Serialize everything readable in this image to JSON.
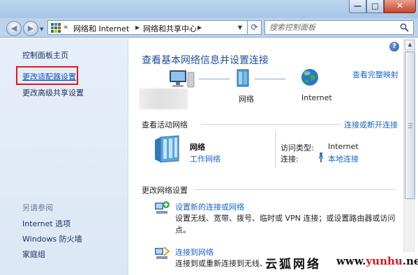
{
  "window": {
    "controls": {
      "minimize": "—",
      "maximize": "□",
      "close": "✕"
    }
  },
  "nav": {
    "back_icon": "back-arrow-icon",
    "forward_icon": "forward-arrow-icon",
    "breadcrumb_prefix": "«",
    "breadcrumbs": [
      "网络和 Internet",
      "网络和共享中心"
    ],
    "search_placeholder": "搜索控制面板"
  },
  "sidebar": {
    "items": [
      {
        "label": "控制面板主页"
      },
      {
        "label": "更改适配器设置",
        "highlighted": true
      },
      {
        "label": "更改高级共享设置"
      }
    ],
    "see_also_heading": "另请参阅",
    "see_also": [
      {
        "label": "Internet 选项"
      },
      {
        "label": "Windows 防火墙"
      },
      {
        "label": "家庭组"
      }
    ]
  },
  "main": {
    "title": "查看基本网络信息并设置连接",
    "full_map_link": "查看完整映射",
    "map_nodes": [
      {
        "label": "",
        "icon": "computer-icon"
      },
      {
        "label": "网络",
        "icon": "network-icon"
      },
      {
        "label": "Internet",
        "icon": "globe-icon"
      }
    ],
    "active_networks": {
      "heading": "查看活动网络",
      "action_link": "连接或断开连接",
      "network_name": "网络",
      "network_type": "工作网络",
      "access_type_label": "访问类型:",
      "access_type_value": "Internet",
      "connection_label": "连接:",
      "connection_value": "本地连接"
    },
    "change_settings": {
      "heading": "更改网络设置",
      "tasks": [
        {
          "link": "设置新的连接或网络",
          "description": "设置无线、宽带、拨号、临时或 VPN 连接；或设置路由器或访问点。"
        },
        {
          "link": "连接到网络",
          "description": "连接到或重新连接到无线、有线、"
        }
      ]
    }
  },
  "watermark": {
    "chinese": "云狐网络",
    "url_prefix": "www.",
    "url_brand": "yunhu",
    "url_suffix": ".net"
  }
}
